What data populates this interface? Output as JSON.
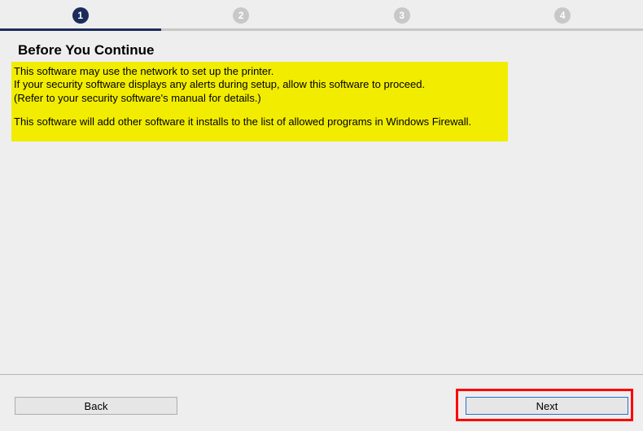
{
  "stepper": {
    "steps": [
      "1",
      "2",
      "3",
      "4"
    ],
    "active_index": 0
  },
  "heading": "Before You Continue",
  "notice": {
    "line1": "This software may use the network to set up the printer.",
    "line2": "If your security software displays any alerts during setup, allow this software to proceed.",
    "line3": "(Refer to your security software's manual for details.)",
    "line4": "This software will add other software it installs to the list of allowed programs in Windows Firewall."
  },
  "buttons": {
    "back": "Back",
    "next": "Next"
  }
}
